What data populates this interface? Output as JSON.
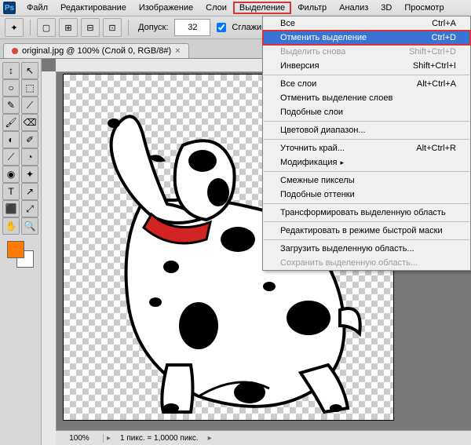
{
  "app": {
    "ps_logo": "Ps"
  },
  "menubar": {
    "items": [
      "Файл",
      "Редактирование",
      "Изображение",
      "Слои",
      "Выделение",
      "Фильтр",
      "Анализ",
      "3D",
      "Просмотр"
    ],
    "highlighted_index": 4
  },
  "toolbar": {
    "tolerance_label": "Допуск:",
    "tolerance_value": "32",
    "antialias_label": "Сглаживание"
  },
  "tab": {
    "title": "original.jpg @ 100% (Слой 0, RGB/8#)",
    "close": "×"
  },
  "statusbar": {
    "zoom": "100%",
    "info": "1 пикс. = 1,0000 пикс."
  },
  "dropdown": {
    "items": [
      {
        "label": "Все",
        "shortcut": "Ctrl+A",
        "type": "item"
      },
      {
        "label": "Отменить выделение",
        "shortcut": "Ctrl+D",
        "type": "item",
        "hl": true
      },
      {
        "label": "Выделить снова",
        "shortcut": "Shift+Ctrl+D",
        "type": "item",
        "disabled": true
      },
      {
        "label": "Инверсия",
        "shortcut": "Shift+Ctrl+I",
        "type": "item"
      },
      {
        "type": "sep"
      },
      {
        "label": "Все слои",
        "shortcut": "Alt+Ctrl+A",
        "type": "item"
      },
      {
        "label": "Отменить выделение слоев",
        "shortcut": "",
        "type": "item"
      },
      {
        "label": "Подобные слои",
        "shortcut": "",
        "type": "item"
      },
      {
        "type": "sep"
      },
      {
        "label": "Цветовой диапазон...",
        "shortcut": "",
        "type": "item"
      },
      {
        "type": "sep"
      },
      {
        "label": "Уточнить край...",
        "shortcut": "Alt+Ctrl+R",
        "type": "item"
      },
      {
        "label": "Модификация",
        "shortcut": "",
        "type": "item",
        "sub": true
      },
      {
        "type": "sep"
      },
      {
        "label": "Смежные пикселы",
        "shortcut": "",
        "type": "item"
      },
      {
        "label": "Подобные оттенки",
        "shortcut": "",
        "type": "item"
      },
      {
        "type": "sep"
      },
      {
        "label": "Трансформировать выделенную область",
        "shortcut": "",
        "type": "item"
      },
      {
        "type": "sep"
      },
      {
        "label": "Редактировать в режиме быстрой маски",
        "shortcut": "",
        "type": "item"
      },
      {
        "type": "sep"
      },
      {
        "label": "Загрузить выделенную область...",
        "shortcut": "",
        "type": "item"
      },
      {
        "label": "Сохранить выделенную область...",
        "shortcut": "",
        "type": "item",
        "disabled": true
      }
    ]
  },
  "tools": {
    "rows": [
      [
        "↕",
        "↖"
      ],
      [
        "○",
        "⬚"
      ],
      [
        "✎",
        "⟋"
      ],
      [
        "🖌",
        "⌫"
      ],
      [
        "◐",
        "✐"
      ],
      [
        "⟋",
        "◔"
      ],
      [
        "◉",
        "✦"
      ],
      [
        "T",
        "↗"
      ],
      [
        "⬛",
        "⤢"
      ],
      [
        "✋",
        "🔍"
      ]
    ]
  }
}
